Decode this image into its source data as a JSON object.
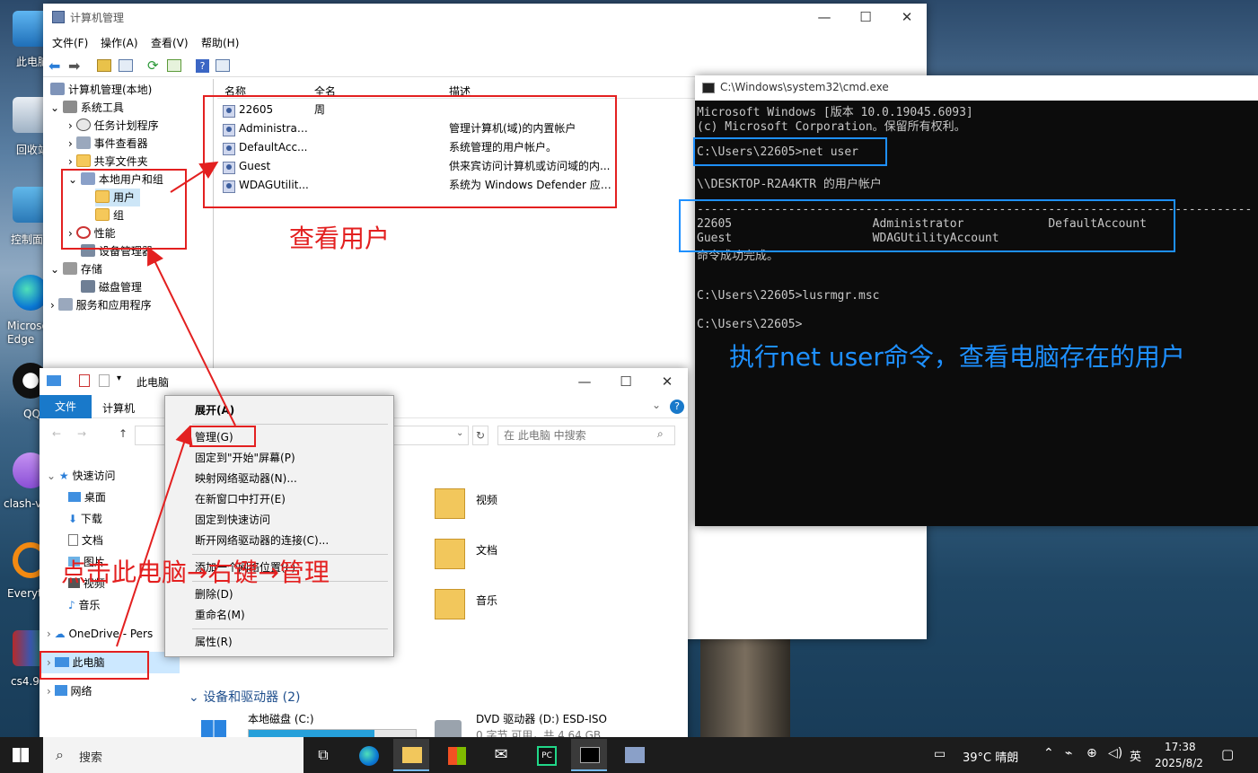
{
  "desktop": {
    "icons": [
      {
        "label": "此电脑"
      },
      {
        "label": "回收站"
      },
      {
        "label": "控制面板"
      },
      {
        "label": "Microsoft Edge"
      },
      {
        "label": "QQ"
      },
      {
        "label": "clash-v"
      },
      {
        "label": "Everything"
      },
      {
        "label": "cs4.9"
      }
    ]
  },
  "mmc": {
    "title": "计算机管理",
    "menu": [
      "文件(F)",
      "操作(A)",
      "查看(V)",
      "帮助(H)"
    ],
    "tree": {
      "root": "计算机管理(本地)",
      "system_tools": "系统工具",
      "task_scheduler": "任务计划程序",
      "event_viewer": "事件查看器",
      "shared_folders": "共享文件夹",
      "local_users": "本地用户和组",
      "users": "用户",
      "groups": "组",
      "performance": "性能",
      "device_manager": "设备管理器",
      "storage": "存储",
      "disk_mgmt": "磁盘管理",
      "services": "服务和应用程序"
    },
    "columns": {
      "name": "名称",
      "fullname": "全名",
      "desc": "描述"
    },
    "rows": [
      {
        "name": "22605",
        "fullname": "周",
        "desc": ""
      },
      {
        "name": "Administrat...",
        "fullname": "",
        "desc": "管理计算机(域)的内置帐户"
      },
      {
        "name": "DefaultAcc...",
        "fullname": "",
        "desc": "系统管理的用户帐户。"
      },
      {
        "name": "Guest",
        "fullname": "",
        "desc": "供来宾访问计算机或访问域的内..."
      },
      {
        "name": "WDAGUtilit...",
        "fullname": "",
        "desc": "系统为 Windows Defender 应用..."
      }
    ]
  },
  "cmd": {
    "title": "C:\\Windows\\system32\\cmd.exe",
    "lines": [
      "Microsoft Windows [版本 10.0.19045.6093]",
      "(c) Microsoft Corporation。保留所有权利。",
      "C:\\Users\\22605>net user",
      "\\\\DESKTOP-R2A4KTR 的用户帐户",
      "-------------------------------------------------------------------------------",
      "22605                    Administrator            DefaultAccount",
      "Guest                    WDAGUtilityAccount",
      "命令成功完成。",
      "C:\\Users\\22605>lusrmgr.msc",
      "C:\\Users\\22605>"
    ]
  },
  "explorer": {
    "title": "此电脑",
    "tabs": [
      "文件",
      "计算机"
    ],
    "search_placeholder": "在 此电脑 中搜索",
    "nav": [
      "快速访问",
      "桌面",
      "下载",
      "文档",
      "图片",
      "视频",
      "音乐",
      "OneDrive - Pers",
      "此电脑",
      "网络"
    ],
    "folders": [
      "视频",
      "文档",
      "音乐"
    ],
    "devices_header": "设备和驱动器 (2)",
    "drives": [
      {
        "name": "本地磁盘 (C:)",
        "detail": ""
      },
      {
        "name": "DVD 驱动器 (D:) ESD-ISO",
        "detail": "0 字节 可用，共 4.64 GB"
      }
    ]
  },
  "context_menu": {
    "items": [
      "展开(A)",
      "管理(G)",
      "固定到\"开始\"屏幕(P)",
      "映射网络驱动器(N)...",
      "在新窗口中打开(E)",
      "固定到快速访问",
      "断开网络驱动器的连接(C)...",
      "添加一个网络位置(L)",
      "删除(D)",
      "重命名(M)",
      "属性(R)"
    ]
  },
  "annotations": {
    "view_users": "查看用户",
    "net_user": "执行net user命令，查看电脑存在的用户",
    "click_pc": "点击此电脑→右键→管理"
  },
  "taskbar": {
    "search": "搜索",
    "weather": "39°C 晴朗",
    "lang": "英",
    "time": "17:38",
    "date": "2025/8/2"
  },
  "colors": {
    "red": "#e32020",
    "blue": "#1e90ff",
    "accent": "#1979ca"
  }
}
